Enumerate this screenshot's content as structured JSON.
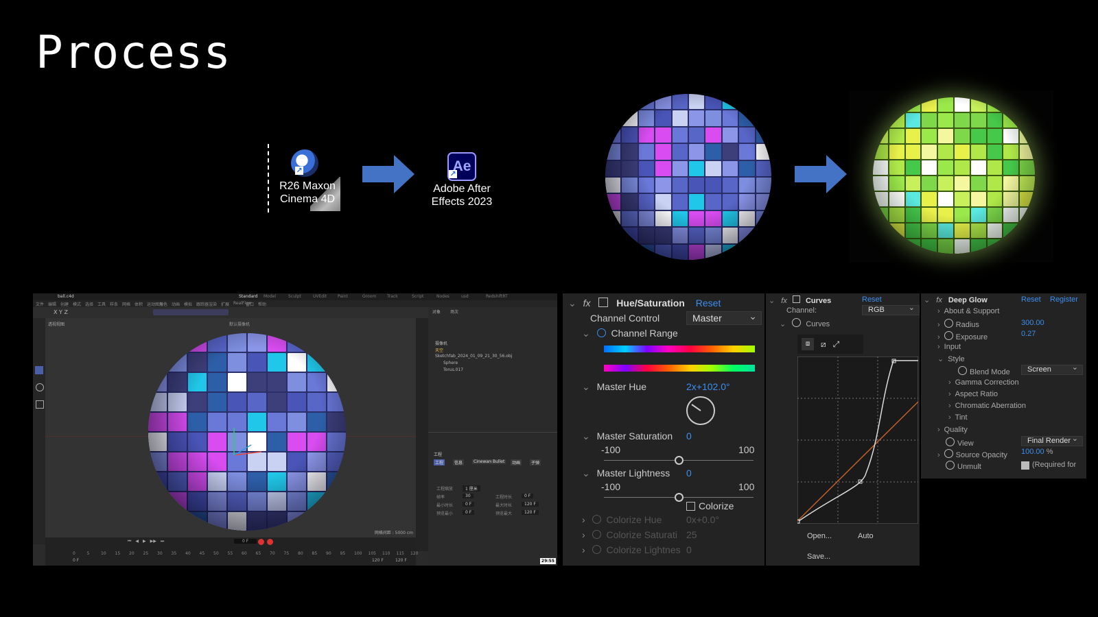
{
  "title": "Process",
  "flow": {
    "c4d_label_1": "R26 Maxon",
    "c4d_label_2": "Cinema 4D",
    "ae_glyph": "Ae",
    "ae_label_1": "Adobe After",
    "ae_label_2": "Effects 2023",
    "arrow_color": "#4472c4"
  },
  "c4d": {
    "file_tab": "ball.c4d",
    "layout_tabs": [
      "Standard",
      "Model",
      "Sculpt",
      "UVEdit",
      "Paint",
      "Groom",
      "Track",
      "Script",
      "Nodes",
      "usd",
      "RedshiftRT"
    ],
    "menu": [
      "文件",
      "编辑",
      "创建",
      "模式",
      "选择",
      "工具",
      "样条",
      "网格",
      "体积",
      "运动图形",
      "角色",
      "动画",
      "模拟",
      "跟踪器",
      "渲染",
      "扩展",
      "RealFlow",
      "窗口",
      "帮助"
    ],
    "viewport_label": "透视视图",
    "camera_label": "默认摄像机",
    "grid_spacing": "网格间距 : 5000 cm",
    "objects_header": [
      "对象",
      "场次"
    ],
    "objects": [
      "摄像机",
      "天空",
      "Sketchfab_2024_01_09_21_30_56.obj",
      "Sphere",
      "Torus.017"
    ],
    "attr_tabs": [
      "工程",
      "信息",
      "Cineware",
      "Bullet",
      "动画",
      "子弹"
    ],
    "attr_section": "工程",
    "attr_fields": [
      {
        "label": "工程缩放",
        "value": "1",
        "unit": "厘米"
      },
      {
        "label": "帧率",
        "value": "30"
      },
      {
        "label": "工程时长",
        "value": "0 F"
      },
      {
        "label": "最小时长",
        "value": "0 F"
      },
      {
        "label": "最大时长",
        "value": "120 F"
      },
      {
        "label": "预览最小",
        "value": "0 F"
      },
      {
        "label": "预览最大",
        "value": "120 F"
      }
    ],
    "timeline_start": "0 F",
    "timeline_current": "0 F",
    "timeline_end": "120 F",
    "timeline_end2": "120 F",
    "ticks": [
      "0",
      "5",
      "10",
      "15",
      "20",
      "25",
      "30",
      "35",
      "40",
      "45",
      "50",
      "55",
      "60",
      "65",
      "70",
      "75",
      "80",
      "85",
      "90",
      "95",
      "100",
      "105",
      "110",
      "115",
      "120"
    ],
    "clock": "29:55"
  },
  "hue_sat": {
    "fx": "fx",
    "name": "Hue/Saturation",
    "reset": "Reset",
    "channel_control_label": "Channel Control",
    "channel_control_value": "Master",
    "channel_range_label": "Channel Range",
    "master_hue_label": "Master Hue",
    "master_hue_value": "2x+102.0°",
    "master_saturation_label": "Master Saturation",
    "master_saturation_value": "0",
    "sat_min": "-100",
    "sat_max": "100",
    "master_lightness_label": "Master Lightness",
    "master_lightness_value": "0",
    "light_min": "-100",
    "light_max": "100",
    "colorize_label": "Colorize",
    "colorize_hue_label": "Colorize Hue",
    "colorize_hue_value": "0x+0.0°",
    "colorize_sat_label": "Colorize Saturati",
    "colorize_sat_value": "25",
    "colorize_light_label": "Colorize Lightnes",
    "colorize_light_value": "0"
  },
  "curves": {
    "fx": "fx",
    "name": "Curves",
    "reset": "Reset",
    "channel_label": "Channel:",
    "channel_value": "RGB",
    "curves_label": "Curves",
    "open": "Open...",
    "auto": "Auto",
    "save": "Save..."
  },
  "deep_glow": {
    "fx": "fx",
    "name": "Deep Glow",
    "reset": "Reset",
    "register": "Register",
    "about": "About & Support",
    "radius_label": "Radius",
    "radius_value": "300.00",
    "exposure_label": "Exposure",
    "exposure_value": "0.27",
    "input": "Input",
    "style": "Style",
    "blend_mode_label": "Blend Mode",
    "blend_mode_value": "Screen",
    "gamma": "Gamma Correction",
    "aspect": "Aspect Ratio",
    "chromatic": "Chromatic Aberration",
    "tint": "Tint",
    "quality": "Quality",
    "view_label": "View",
    "view_value": "Final Render",
    "source_opacity_label": "Source Opacity",
    "source_opacity_value": "100.00",
    "source_opacity_unit": "%",
    "unmult_label": "Unmult",
    "unmult_note": "(Required for"
  }
}
